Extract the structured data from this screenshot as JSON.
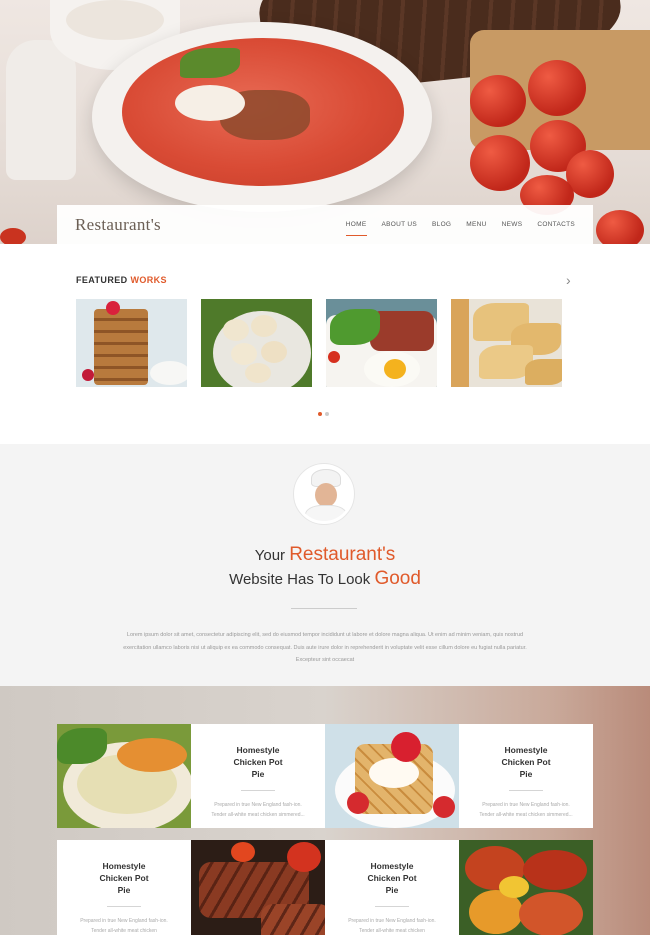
{
  "brand": {
    "logo": "Restaurant's",
    "accent": "#e05a2b"
  },
  "nav": {
    "items": [
      {
        "label": "HOME",
        "active": true
      },
      {
        "label": "ABOUT US",
        "active": false
      },
      {
        "label": "BLOG",
        "active": false
      },
      {
        "label": "MENU",
        "active": false
      },
      {
        "label": "NEWS",
        "active": false
      },
      {
        "label": "CONTACTS",
        "active": false
      }
    ]
  },
  "featured": {
    "title_a": "FEATURED",
    "title_b": "WORKS",
    "next_icon": "chevron-right-icon",
    "next_glyph": "›",
    "slides": [
      "cake",
      "dumplings",
      "steak-egg",
      "crepes"
    ],
    "pager": {
      "current": 1,
      "total": 2
    }
  },
  "about": {
    "line1_pre": "Your",
    "line1_hl": "Restaurant's",
    "line2_pre": "Website Has To Look",
    "line2_hl": "Good",
    "body": "Lorem ipsum dolor sit amet, consectetur adipiscing elit, sed do eiusmod tempor incididunt ut labore et dolore magna aliqua. Ut enim ad minim veniam, quis nostrud exercitation ullamco laboris nisi ut aliquip ex ea commodo consequat. Duis aute irure dolor in reprehenderit in voluptate velit esse cillum dolore eu fugiat nulla pariatur. Excepteur sint occaecat"
  },
  "menu": {
    "cards": [
      {
        "title": "Homestyle Chicken Pot Pie",
        "desc": "Prepared in true New England fash-ion. Tender all-white meat chicken simmered..."
      },
      {
        "title": "Homestyle Chicken Pot Pie",
        "desc": "Prepared in true New England fash-ion. Tender all-white meat chicken simmered..."
      },
      {
        "title": "Homestyle Chicken Pot Pie",
        "desc": "Prepared in true New England fash-ion. Tender all-white meat chicken"
      },
      {
        "title": "Homestyle Chicken Pot Pie",
        "desc": "Prepared in true New England fash-ion. Tender all-white meat chicken"
      }
    ]
  }
}
